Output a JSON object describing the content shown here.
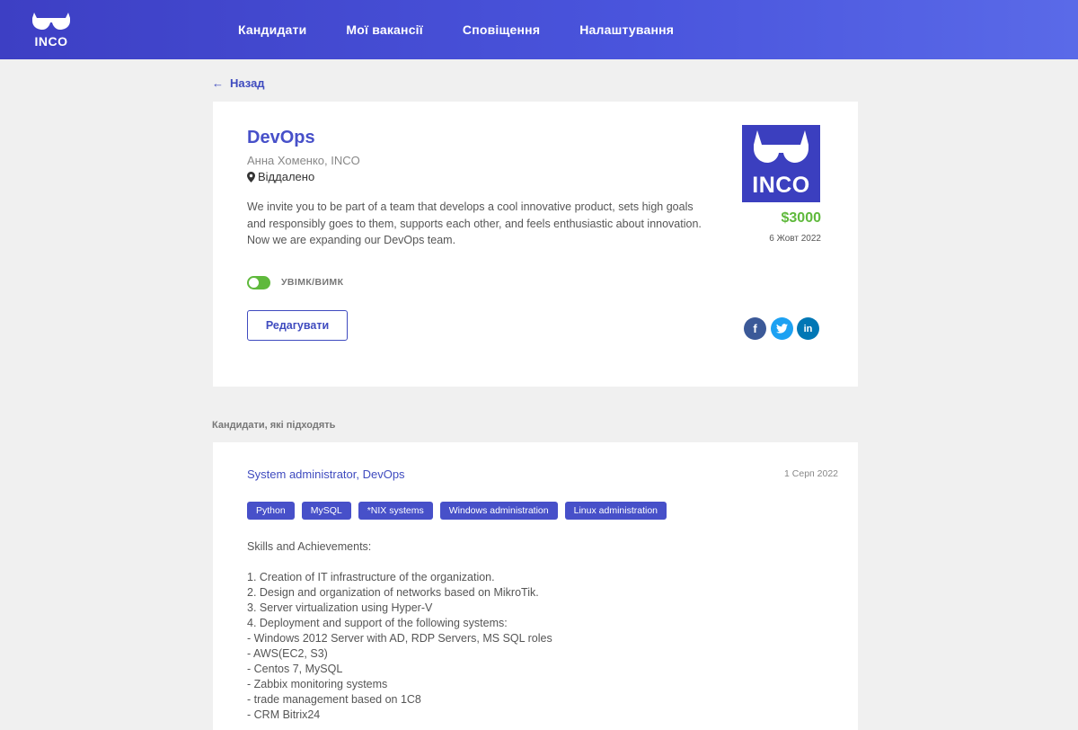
{
  "header": {
    "logo_text": "INCO",
    "nav": [
      {
        "label": "Кандидати"
      },
      {
        "label": "Мої вакансії"
      },
      {
        "label": "Сповіщення"
      },
      {
        "label": "Налаштування"
      }
    ]
  },
  "back_label": "Назад",
  "job": {
    "title": "DevOps",
    "author": "Анна Хоменко, INCO",
    "location": "Віддалено",
    "description": "We invite you to be part of a team that develops a cool innovative product, sets high goals and responsibly goes to them, supports each other, and feels enthusiastic about innovation. Now we are expanding our DevOps team.",
    "toggle_label": "УВІМК/ВИМК",
    "toggle_on": true,
    "edit_label": "Редагувати",
    "company_logo_text": "INCO",
    "salary": "$3000",
    "date": "6 Жовт 2022",
    "share": {
      "facebook": "f",
      "twitter": "t",
      "linkedin": "in"
    }
  },
  "candidates_section_title": "Кандидати, які підходять",
  "candidate": {
    "title": "System administrator, DevOps",
    "date": "1 Серп 2022",
    "tags": [
      "Python",
      "MySQL",
      "*NIX systems",
      "Windows administration",
      "Linux administration"
    ],
    "text": "Skills and Achievements:\n\n1. Creation of IT infrastructure of the organization.\n2. Design and organization of networks based on MikroTik.\n3. Server virtualization using Hyper-V\n4. Deployment and support of the following systems:\n- Windows 2012 Server with AD, RDP Servers, MS SQL roles\n- AWS(EC2, S3)\n- Centos 7, MySQL\n- Zabbix monitoring systems\n- trade management based on 1C8\n- CRM Bitrix24"
  },
  "colors": {
    "brand": "#3d3fc4",
    "accent_green": "#5fb93c",
    "tag_bg": "#4750c9"
  }
}
